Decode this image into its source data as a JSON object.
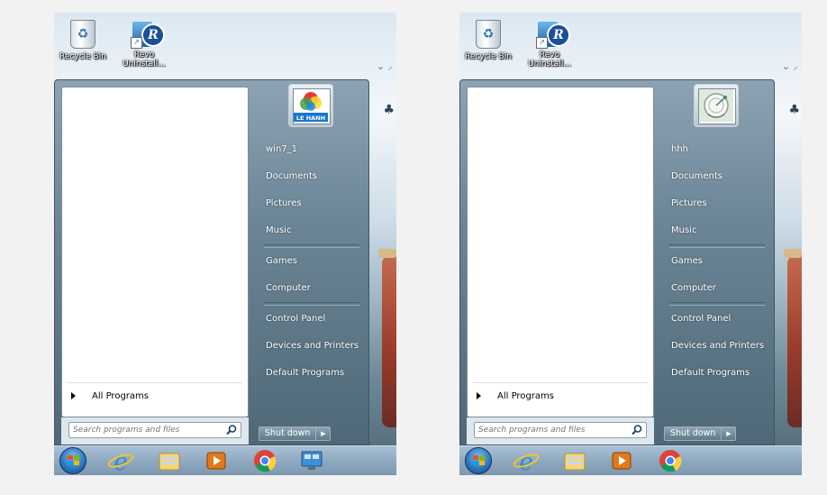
{
  "screens": [
    {
      "desktop_icons": [
        {
          "label": "Recycle Bin",
          "icon": "recycle-bin-icon"
        },
        {
          "label": "Revo Uninstall...",
          "icon": "revo-uninstaller-icon"
        }
      ],
      "user_tile": {
        "caption": "LE HANH",
        "icon": "le-hanh-logo-icon"
      },
      "links": [
        "win7_1",
        "Documents",
        "Pictures",
        "Music",
        "Games",
        "Computer",
        "Control Panel",
        "Devices and Printers",
        "Default Programs"
      ],
      "all_programs": "All Programs",
      "search_placeholder": "Search programs and files",
      "shutdown_label": "Shut down",
      "taskbar_icons": [
        "start-orb-icon",
        "internet-explorer-icon",
        "windows-explorer-icon",
        "media-player-icon",
        "chrome-icon",
        "remote-desktop-icon"
      ]
    },
    {
      "desktop_icons": [
        {
          "label": "Recycle Bin",
          "icon": "recycle-bin-icon"
        },
        {
          "label": "Revo Uninstall...",
          "icon": "revo-uninstaller-icon"
        }
      ],
      "user_tile": {
        "caption": "",
        "icon": "satellite-dish-icon"
      },
      "links": [
        "hhh",
        "Documents",
        "Pictures",
        "Music",
        "Games",
        "Computer",
        "Control Panel",
        "Devices and Printers",
        "Default Programs"
      ],
      "all_programs": "All Programs",
      "search_placeholder": "Search programs and files",
      "shutdown_label": "Shut down",
      "taskbar_icons": [
        "start-orb-icon",
        "internet-explorer-icon",
        "windows-explorer-icon",
        "media-player-icon",
        "chrome-icon"
      ]
    }
  ],
  "colors": {
    "menu_blue": "#5d7787",
    "taskbar": "#8fa9c0",
    "link_text": "#ffffff"
  }
}
